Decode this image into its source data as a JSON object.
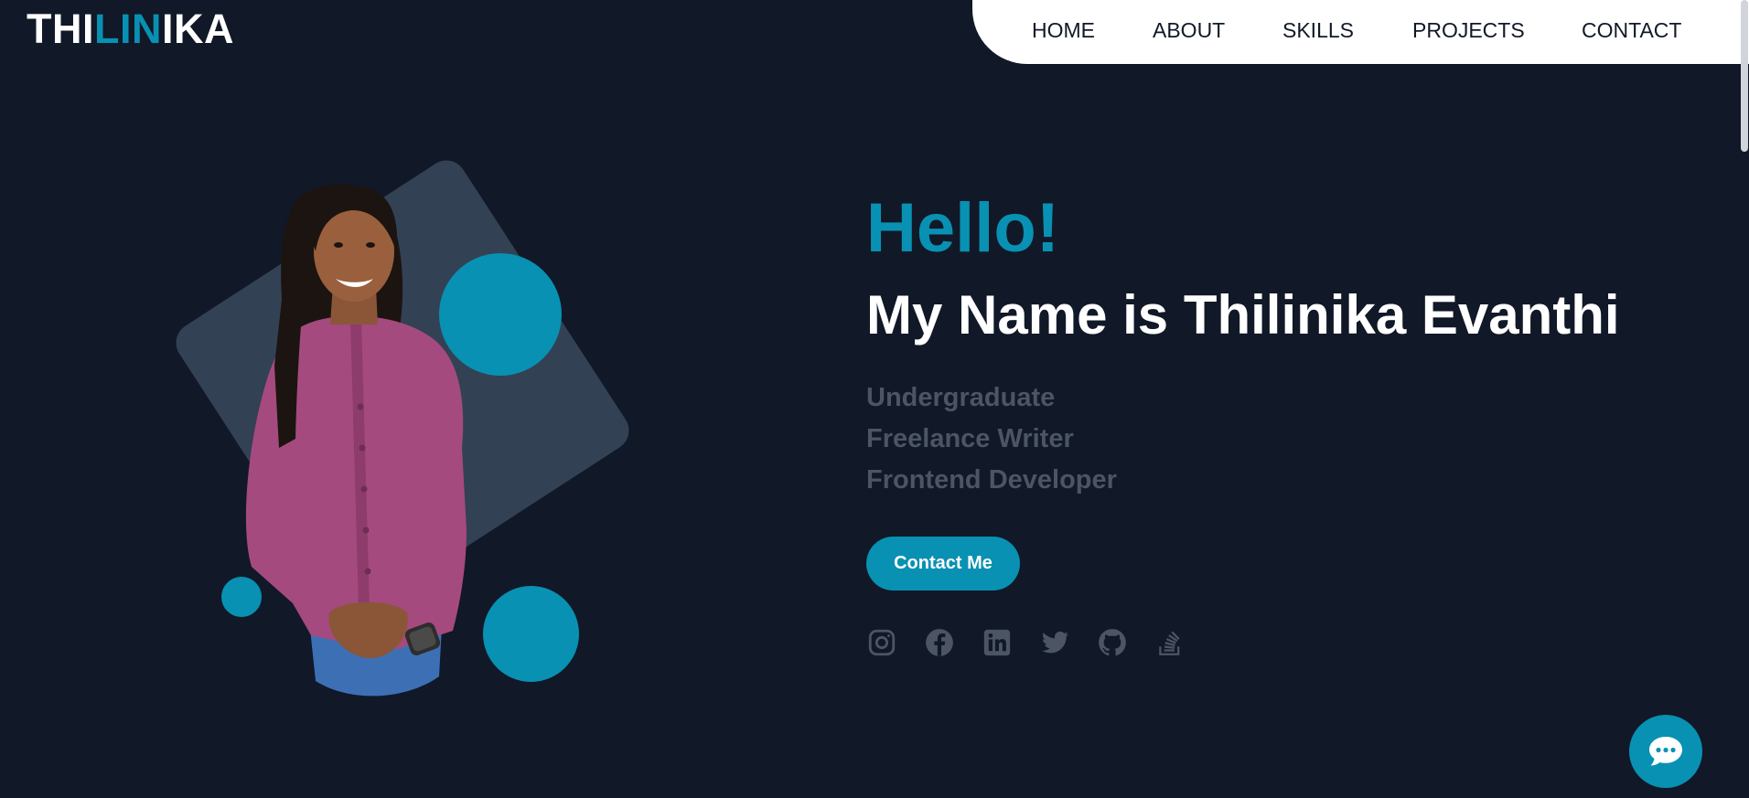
{
  "logo": {
    "part1": "THI",
    "part2": "LIN",
    "part3": "IKA"
  },
  "nav": {
    "items": [
      {
        "label": "HOME"
      },
      {
        "label": "ABOUT"
      },
      {
        "label": "SKILLS"
      },
      {
        "label": "PROJECTS"
      },
      {
        "label": "CONTACT"
      }
    ]
  },
  "hero": {
    "greeting": "Hello!",
    "name": "My Name is Thilinika Evanthi",
    "roles": [
      "Undergraduate",
      "Freelance Writer",
      "Frontend Developer"
    ],
    "cta_label": "Contact Me",
    "photo_alt": "portrait-photo"
  },
  "socials": [
    {
      "icon": "instagram-icon"
    },
    {
      "icon": "facebook-icon"
    },
    {
      "icon": "linkedin-icon"
    },
    {
      "icon": "twitter-icon"
    },
    {
      "icon": "github-icon"
    },
    {
      "icon": "stackoverflow-icon"
    }
  ],
  "chat": {
    "icon": "chat-bubble-icon"
  },
  "colors": {
    "background": "#111827",
    "accent": "#0891b2",
    "diamond": "#334155",
    "muted_text": "#4b5563",
    "nav_bg": "#ffffff"
  }
}
